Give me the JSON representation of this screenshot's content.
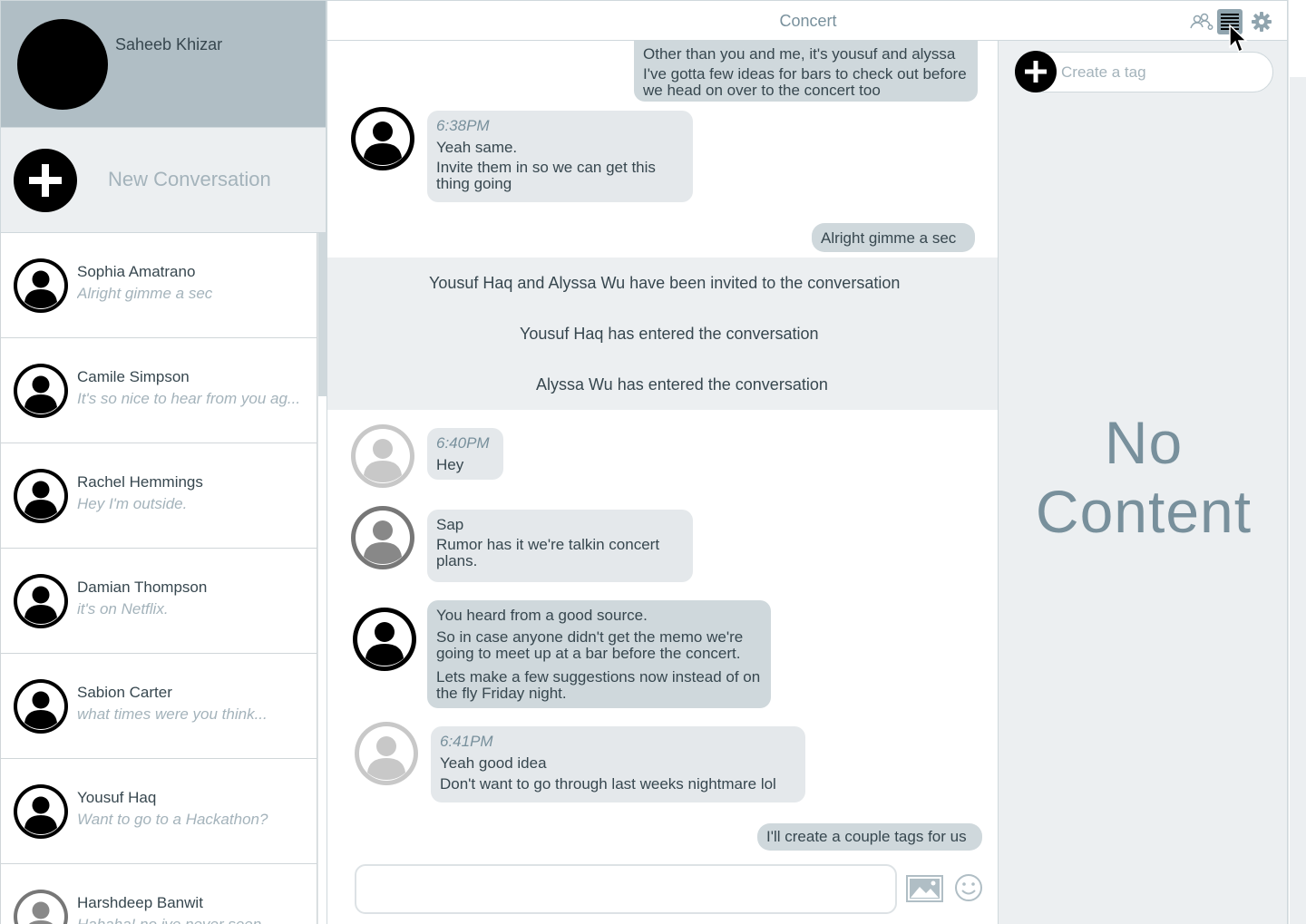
{
  "profile": {
    "name": "Saheeb Khizar"
  },
  "new_conversation": {
    "label": "New Conversation"
  },
  "conversations": [
    {
      "name": "Sophia Amatrano",
      "preview": "Alright gimme a sec"
    },
    {
      "name": "Camile Simpson",
      "preview": "It's so nice to hear from you ag..."
    },
    {
      "name": "Rachel Hemmings",
      "preview": "Hey I'm outside."
    },
    {
      "name": "Damian Thompson",
      "preview": "it's on Netflix."
    },
    {
      "name": "Sabion Carter",
      "preview": "what times were you think..."
    },
    {
      "name": "Yousuf Haq",
      "preview": "Want to go to a Hackathon?"
    },
    {
      "name": "Harshdeep Banwit",
      "preview": "Hahaha! no ive never seen"
    }
  ],
  "header": {
    "title": "Concert",
    "icons": [
      "people-icon",
      "list-icon",
      "gear-icon"
    ]
  },
  "messages": {
    "m1": {
      "lines": [
        "Other than you and me, it's yousuf and alyssa",
        "I've gotta few ideas for bars to check out before we head on over to the concert too"
      ]
    },
    "m2": {
      "time": "6:38PM",
      "lines": [
        "Yeah same.",
        "Invite them in so we can get this thing going"
      ]
    },
    "m3": {
      "lines": [
        "Alright gimme a sec"
      ]
    },
    "m4": {
      "time": "6:40PM",
      "lines": [
        "Hey"
      ]
    },
    "m5": {
      "lines": [
        "Sap",
        "Rumor has it we're talkin concert plans."
      ]
    },
    "m6": {
      "lines": [
        "You heard from a good source.",
        "So in case anyone didn't get the memo we're going to meet up at a bar before the concert.",
        "Lets make a few suggestions now instead of on the fly Friday night."
      ]
    },
    "m7": {
      "time": "6:41PM",
      "lines": [
        "Yeah good idea",
        "Don't want to go through last weeks nightmare lol"
      ]
    },
    "m8": {
      "lines": [
        "I'll create a couple tags for us"
      ]
    }
  },
  "system_messages": [
    "Yousuf Haq and Alyssa Wu have been invited to the conversation",
    "Yousuf Haq has entered the conversation",
    "Alyssa Wu has entered the conversation"
  ],
  "composer": {
    "value": "",
    "icons": [
      "image-icon",
      "smiley-icon"
    ]
  },
  "tags": {
    "placeholder": "Create a tag",
    "empty_state": "No Content"
  },
  "colors": {
    "sidebar_header": "#b0bec5",
    "panel_bg": "#eceff1",
    "bubble": "#e4e8eb",
    "bubble_dark": "#cfd8dc",
    "muted_text": "#78909c"
  }
}
